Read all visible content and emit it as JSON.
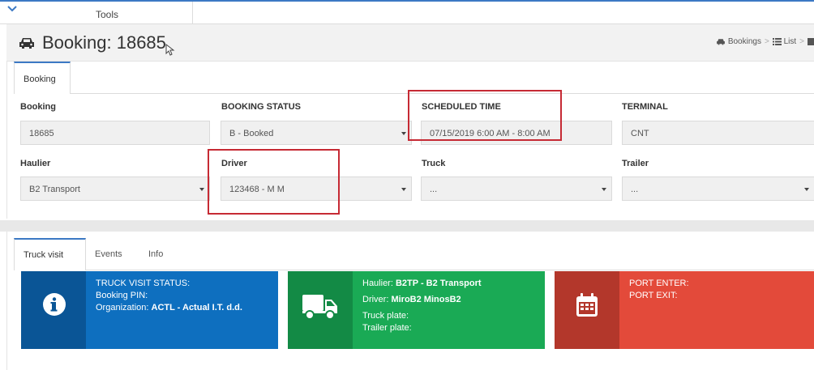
{
  "topbar": {
    "tools_label": "Tools"
  },
  "header": {
    "title": "Booking: 18685",
    "breadcrumb": {
      "bookings": "Bookings",
      "list": "List"
    }
  },
  "booking_tab": "Booking",
  "fields": {
    "booking": {
      "label": "Booking",
      "value": "18685"
    },
    "booking_status": {
      "label": "BOOKING STATUS",
      "value": "B - Booked"
    },
    "scheduled_time": {
      "label": "SCHEDULED TIME",
      "value": "07/15/2019 6:00 AM - 8:00 AM"
    },
    "terminal": {
      "label": "TERMINAL",
      "value": "CNT"
    },
    "haulier": {
      "label": "Haulier",
      "value": "B2 Transport"
    },
    "driver": {
      "label": "Driver",
      "value": "123468 - M M"
    },
    "truck": {
      "label": "Truck",
      "value": "..."
    },
    "trailer": {
      "label": "Trailer",
      "value": "..."
    }
  },
  "tabs2": {
    "truck_visit": "Truck visit",
    "events": "Events",
    "info": "Info"
  },
  "cards": {
    "status": {
      "line1": "TRUCK VISIT STATUS:",
      "line2": "Booking PIN:",
      "org_label": "Organization:",
      "org_value": "ACTL - Actual I.T. d.d."
    },
    "haulier": {
      "haulier_label": "Haulier:",
      "haulier_value": "B2TP - B2 Transport",
      "driver_label": "Driver:",
      "driver_value": "MiroB2 MinosB2",
      "truck_plate": "Truck plate:",
      "trailer_plate": "Trailer plate:"
    },
    "port": {
      "enter": "PORT ENTER:",
      "exit": "PORT EXIT:"
    }
  },
  "colors": {
    "accent": "#3c79c4",
    "highlight": "#c62a34",
    "blue_card": "#0e6fbf",
    "blue_card_dark": "#0a5596",
    "green_card": "#1aaa55",
    "green_card_dark": "#138a45",
    "red_card": "#e34a3a",
    "red_card_dark": "#b3372b"
  },
  "icons": {
    "menu": "chevron-down-icon",
    "header": "car-icon",
    "breadcrumb_bookings": "car-icon",
    "breadcrumb_list": "list-icon",
    "status_card": "info-icon",
    "haulier_card": "truck-icon",
    "port_card": "calendar-icon"
  }
}
